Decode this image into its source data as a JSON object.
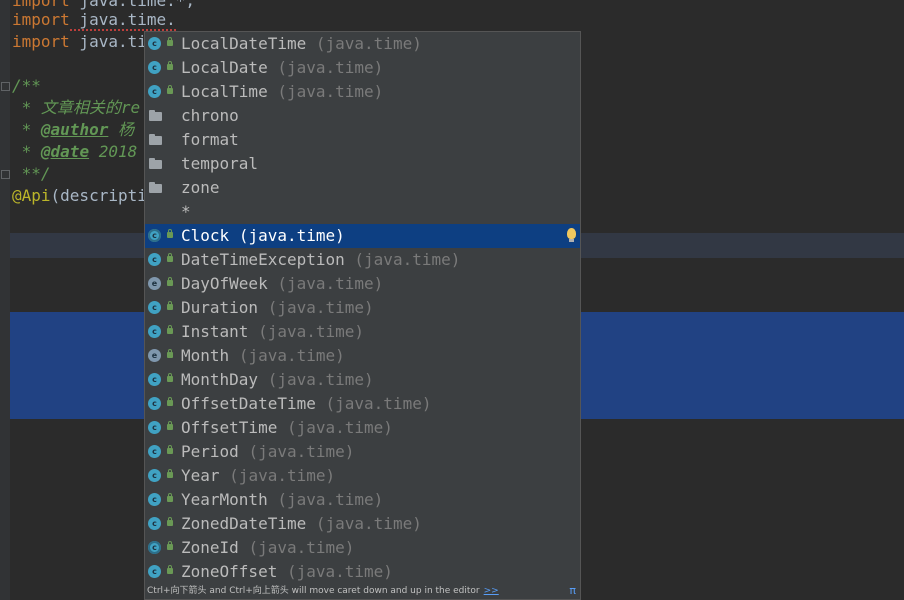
{
  "editor": {
    "line0": {
      "keyword": "import",
      "text": " java.time.*;"
    },
    "line1": {
      "keyword": "import",
      "text": " java.time."
    },
    "line2": {
      "keyword": "import",
      "text": " java.ti"
    },
    "line4": {
      "text": "/**"
    },
    "line5": {
      "text": " * 文章相关的re"
    },
    "line6": {
      "prefix": " * ",
      "tag": "@author",
      "text": " 杨"
    },
    "line7": {
      "prefix": " * ",
      "tag": "@date",
      "text": " 2018"
    },
    "line8": {
      "text": " **/"
    },
    "line9": {
      "annotation": "@Api",
      "text": "(descripti"
    }
  },
  "completion": {
    "items": [
      {
        "icon": "class",
        "name": "LocalDateTime",
        "pkg": "(java.time)"
      },
      {
        "icon": "class",
        "name": "LocalDate",
        "pkg": "(java.time)"
      },
      {
        "icon": "class",
        "name": "LocalTime",
        "pkg": "(java.time)"
      },
      {
        "icon": "folder",
        "name": "chrono",
        "pkg": ""
      },
      {
        "icon": "folder",
        "name": "format",
        "pkg": ""
      },
      {
        "icon": "folder",
        "name": "temporal",
        "pkg": ""
      },
      {
        "icon": "folder",
        "name": "zone",
        "pkg": ""
      },
      {
        "icon": "none",
        "name": "*",
        "pkg": ""
      },
      {
        "icon": "abstract",
        "name": "Clock",
        "pkg": "(java.time)",
        "selected": true
      },
      {
        "icon": "class",
        "name": "DateTimeException",
        "pkg": "(java.time)"
      },
      {
        "icon": "enum",
        "name": "DayOfWeek",
        "pkg": "(java.time)"
      },
      {
        "icon": "class",
        "name": "Duration",
        "pkg": "(java.time)"
      },
      {
        "icon": "class",
        "name": "Instant",
        "pkg": "(java.time)"
      },
      {
        "icon": "enum",
        "name": "Month",
        "pkg": "(java.time)"
      },
      {
        "icon": "class",
        "name": "MonthDay",
        "pkg": "(java.time)"
      },
      {
        "icon": "class",
        "name": "OffsetDateTime",
        "pkg": "(java.time)"
      },
      {
        "icon": "class",
        "name": "OffsetTime",
        "pkg": "(java.time)"
      },
      {
        "icon": "class",
        "name": "Period",
        "pkg": "(java.time)"
      },
      {
        "icon": "class",
        "name": "Year",
        "pkg": "(java.time)"
      },
      {
        "icon": "class",
        "name": "YearMonth",
        "pkg": "(java.time)"
      },
      {
        "icon": "class",
        "name": "ZonedDateTime",
        "pkg": "(java.time)"
      },
      {
        "icon": "abstract",
        "name": "ZoneId",
        "pkg": "(java.time)"
      },
      {
        "icon": "class",
        "name": "ZoneOffset",
        "pkg": "(java.time)"
      }
    ],
    "footer": {
      "hint": "Ctrl+向下箭头 and Ctrl+向上箭头 will move caret down and up in the editor",
      "more": ">>",
      "pi": "π"
    }
  },
  "colors": {
    "background": "#2b2b2b",
    "keyword": "#cc7832",
    "comment": "#629755",
    "selection": "#214283",
    "popup_selected": "#0d3f82"
  }
}
